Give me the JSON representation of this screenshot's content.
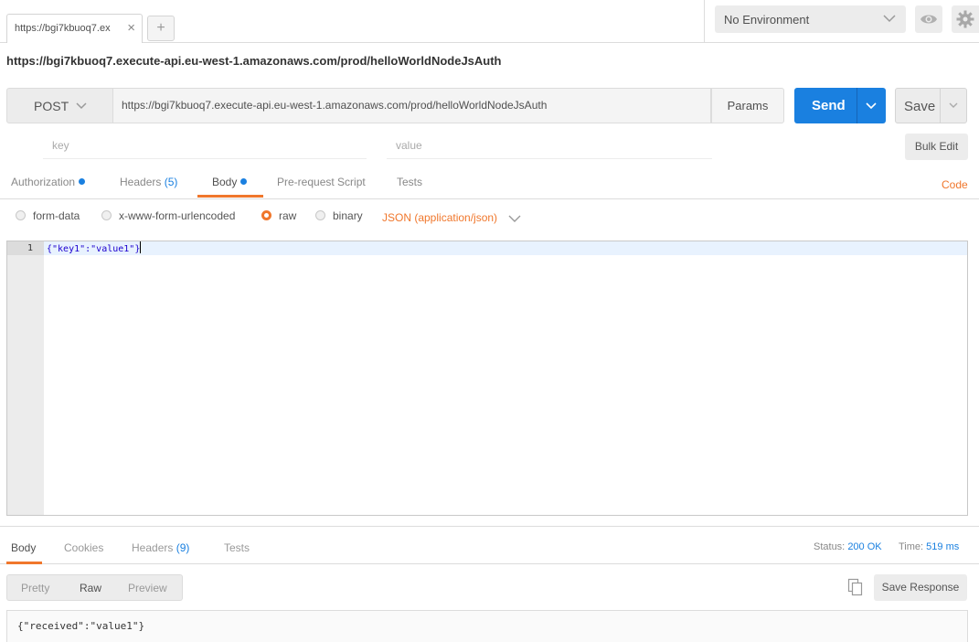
{
  "tabs": [
    {
      "label": "https://bgi7kbuoq7.ex",
      "close": "×"
    }
  ],
  "add_tab": "+",
  "environment": {
    "selected": "No Environment"
  },
  "request_title": "https://bgi7kbuoq7.execute-api.eu-west-1.amazonaws.com/prod/helloWorldNodeJsAuth",
  "url_bar": {
    "method": "POST",
    "url": "https://bgi7kbuoq7.execute-api.eu-west-1.amazonaws.com/prod/helloWorldNodeJsAuth",
    "params_label": "Params",
    "send_label": "Send",
    "save_label": "Save"
  },
  "kv_row": {
    "key_placeholder": "key",
    "value_placeholder": "value",
    "bulk_edit": "Bulk Edit"
  },
  "request_tabs": {
    "authorization": "Authorization",
    "headers": "Headers",
    "headers_count": "(5)",
    "body": "Body",
    "pre_request": "Pre-request Script",
    "tests": "Tests",
    "code": "Code"
  },
  "body_types": {
    "form_data": "form-data",
    "urlencoded": "x-www-form-urlencoded",
    "raw": "raw",
    "binary": "binary",
    "selected": "raw",
    "content_type": "JSON (application/json)"
  },
  "editor": {
    "lines": [
      {
        "num": "1",
        "text": "{\"key1\":\"value1\"}"
      }
    ]
  },
  "response": {
    "tabs": {
      "body": "Body",
      "cookies": "Cookies",
      "headers": "Headers",
      "headers_count": "(9)",
      "tests": "Tests"
    },
    "status_label": "Status:",
    "status_value": "200 OK",
    "time_label": "Time:",
    "time_value": "519 ms",
    "views": {
      "pretty": "Pretty",
      "raw": "Raw",
      "preview": "Preview"
    },
    "save_response": "Save Response",
    "body": "{\"received\":\"value1\"}"
  },
  "colors": {
    "accent": "#f0772c",
    "primary": "#1a80e0"
  },
  "icons": [
    "close-icon",
    "plus-icon",
    "chevron-down-icon",
    "eye-icon",
    "gear-icon",
    "copy-icon"
  ]
}
